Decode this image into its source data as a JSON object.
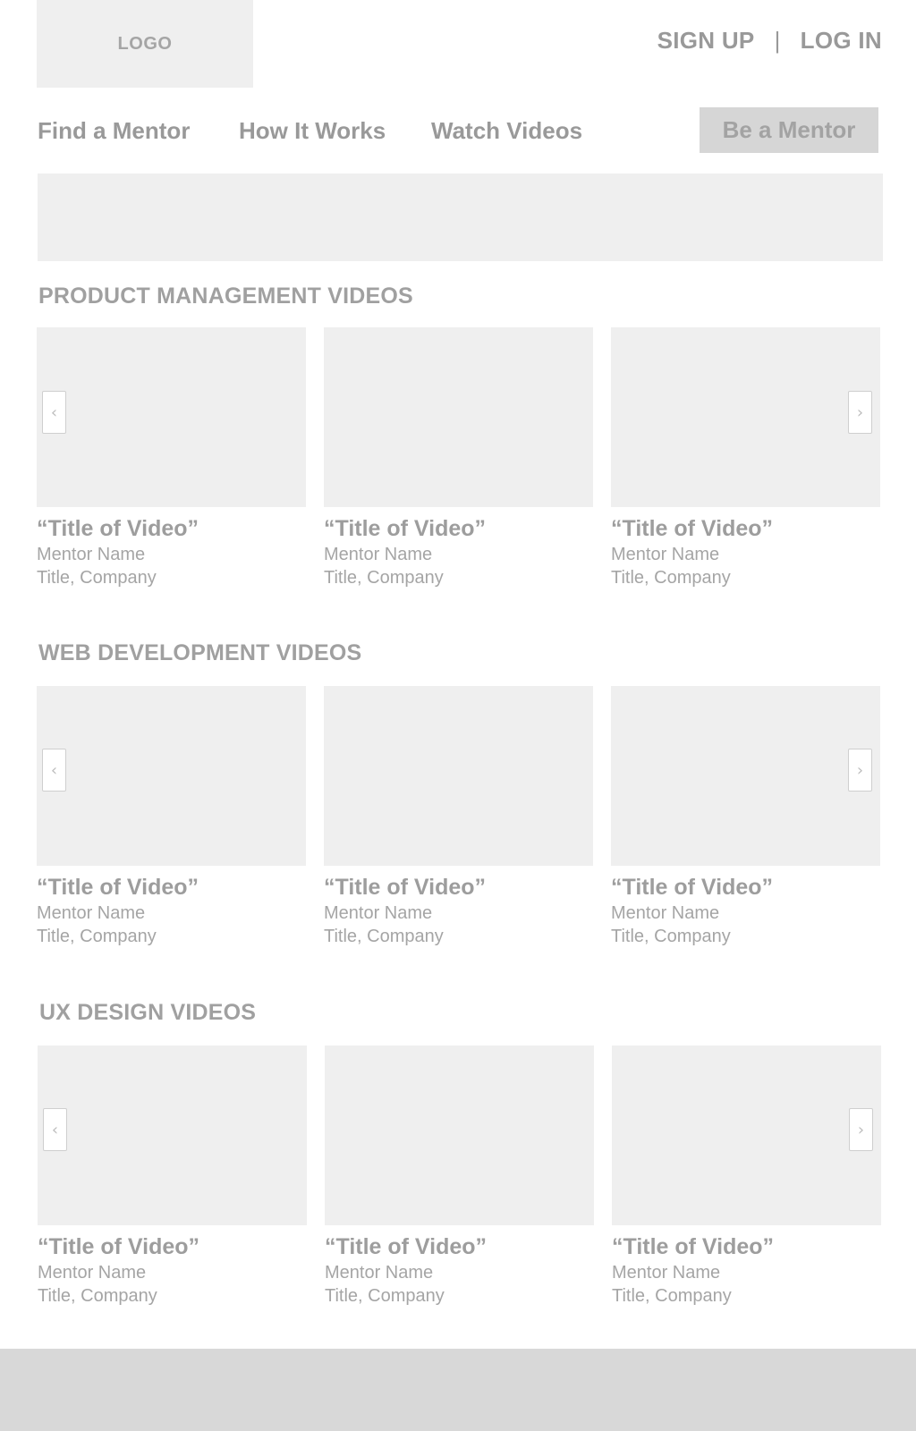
{
  "header": {
    "logo": "LOGO",
    "sign_up": "SIGN UP",
    "separator": "|",
    "log_in": "LOG IN"
  },
  "nav": {
    "items": [
      {
        "label": "Find a Mentor"
      },
      {
        "label": "How It Works"
      },
      {
        "label": "Watch Videos"
      }
    ],
    "cta": "Be a Mentor"
  },
  "sections": [
    {
      "title": "PRODUCT MANAGEMENT VIDEOS",
      "videos": [
        {
          "title": "“Title of Video”",
          "mentor": "Mentor Name",
          "meta": "Title, Company"
        },
        {
          "title": "“Title of Video”",
          "mentor": "Mentor Name",
          "meta": "Title, Company"
        },
        {
          "title": "“Title of Video”",
          "mentor": "Mentor Name",
          "meta": "Title, Company"
        }
      ]
    },
    {
      "title": "WEB DEVELOPMENT VIDEOS",
      "videos": [
        {
          "title": "“Title of Video”",
          "mentor": "Mentor Name",
          "meta": "Title, Company"
        },
        {
          "title": "“Title of Video”",
          "mentor": "Mentor Name",
          "meta": "Title, Company"
        },
        {
          "title": "“Title of Video”",
          "mentor": "Mentor Name",
          "meta": "Title, Company"
        }
      ]
    },
    {
      "title": "UX DESIGN VIDEOS",
      "videos": [
        {
          "title": "“Title of Video”",
          "mentor": "Mentor Name",
          "meta": "Title, Company"
        },
        {
          "title": "“Title of Video”",
          "mentor": "Mentor Name",
          "meta": "Title, Company"
        },
        {
          "title": "“Title of Video”",
          "mentor": "Mentor Name",
          "meta": "Title, Company"
        }
      ]
    }
  ],
  "icons": {
    "prev": "chevron-left-icon",
    "next": "chevron-right-icon",
    "prev_glyph": "‹",
    "next_glyph": "›"
  },
  "colors": {
    "placeholder": "#efefef",
    "text": "#999999",
    "button": "#d6d6d6",
    "footer": "#d8d8d8"
  }
}
